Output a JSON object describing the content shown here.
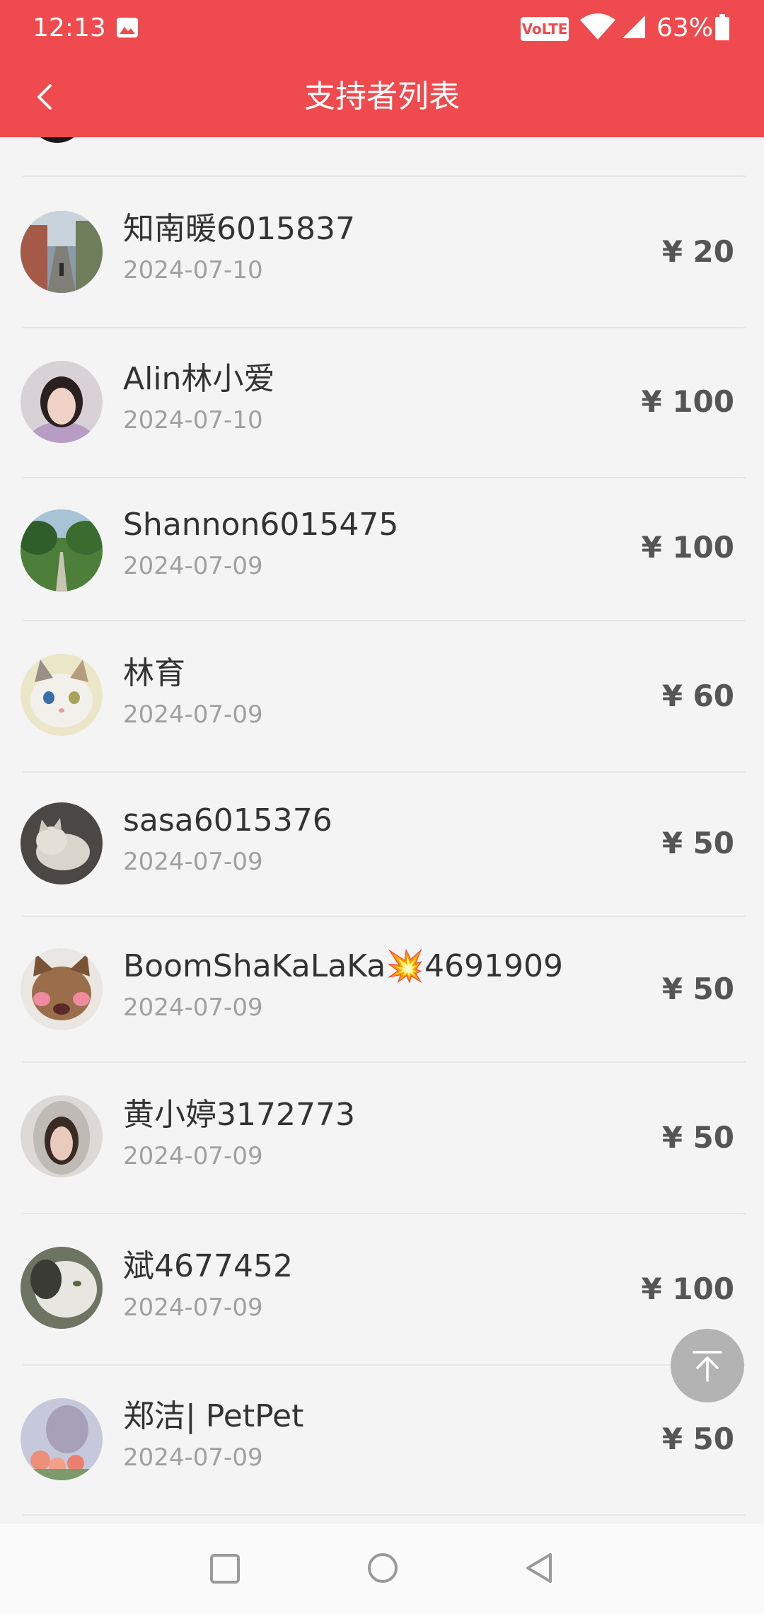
{
  "status_bar": {
    "time": "12:13",
    "network_badge": "VoLTE",
    "battery": "63%"
  },
  "header": {
    "title": "支持者列表"
  },
  "supporters": [
    {
      "name": "知南暖6015837",
      "date": "2024-07-10",
      "amount": "¥ 20"
    },
    {
      "name": "Alin林小爱",
      "date": "2024-07-10",
      "amount": "¥ 100"
    },
    {
      "name": "Shannon6015475",
      "date": "2024-07-09",
      "amount": "¥ 100"
    },
    {
      "name": "林育",
      "date": "2024-07-09",
      "amount": "¥ 60"
    },
    {
      "name": "sasa6015376",
      "date": "2024-07-09",
      "amount": "¥ 50"
    },
    {
      "name": "BoomShaKaLaKa💥4691909",
      "date": "2024-07-09",
      "amount": "¥ 50"
    },
    {
      "name": "黄小婷3172773",
      "date": "2024-07-09",
      "amount": "¥ 50"
    },
    {
      "name": "斌4677452",
      "date": "2024-07-09",
      "amount": "¥ 100"
    },
    {
      "name": "郑洁| PetPet",
      "date": "2024-07-09",
      "amount": "¥ 50"
    }
  ],
  "colors": {
    "brand_red": "#ef4a4d",
    "amount_text": "#555555",
    "date_text": "#a0a0a0"
  },
  "icons": {
    "back": "chevron-left-icon",
    "scroll_top": "arrow-up-to-top-icon",
    "nav": [
      "square-icon",
      "circle-icon",
      "triangle-left-icon"
    ]
  }
}
